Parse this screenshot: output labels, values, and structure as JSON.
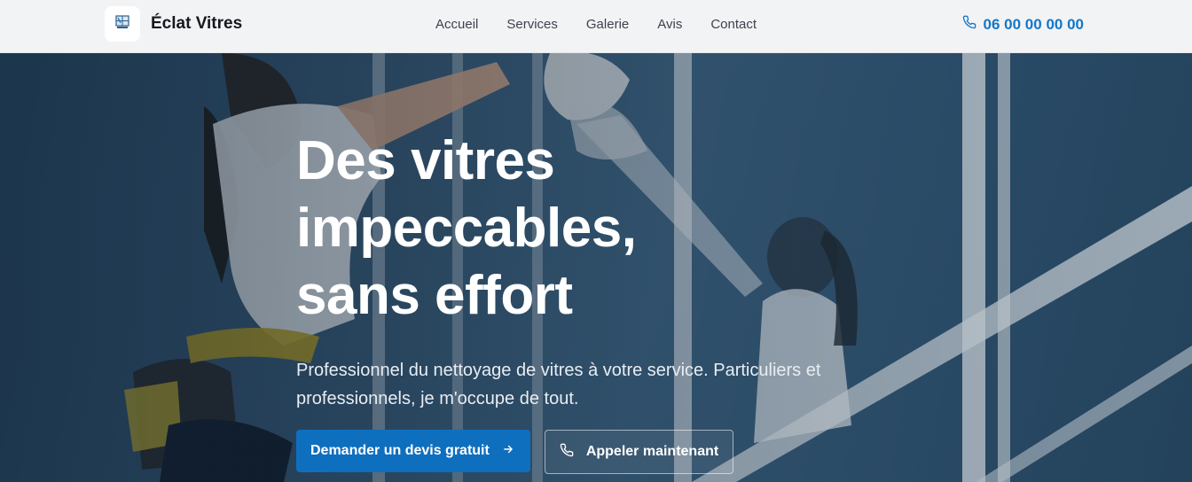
{
  "header": {
    "brand": "Éclat Vitres",
    "logo_icon": "window-logo-icon",
    "nav": [
      {
        "label": "Accueil"
      },
      {
        "label": "Services"
      },
      {
        "label": "Galerie"
      },
      {
        "label": "Avis"
      },
      {
        "label": "Contact"
      }
    ],
    "phone": "06 00 00 00 00",
    "phone_icon": "phone-icon"
  },
  "hero": {
    "title_line1": "Des vitres",
    "title_line2": "impeccables,",
    "title_line3": "sans effort",
    "subtitle": "Professionnel du nettoyage de vitres à votre service. Particuliers et professionnels, je m'occupe de tout.",
    "cta_primary": "Demander un devis gratuit",
    "cta_secondary": "Appeler maintenant"
  },
  "colors": {
    "accent": "#1477c6",
    "button": "#0f6fbf"
  }
}
